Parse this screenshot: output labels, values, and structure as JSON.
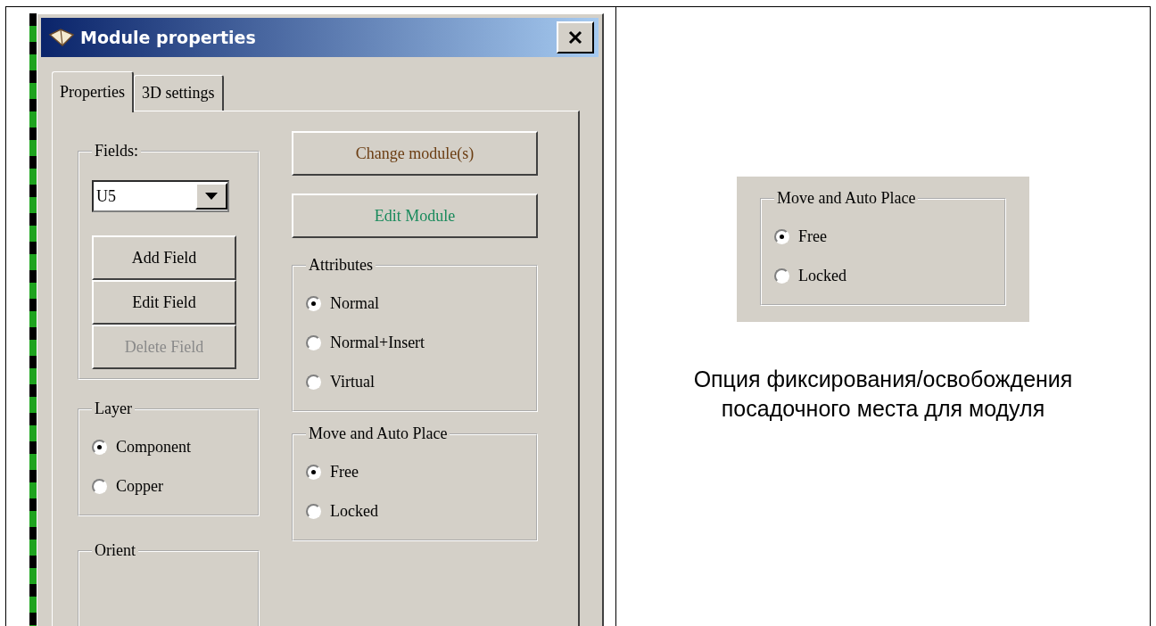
{
  "window": {
    "title": "Module properties"
  },
  "tabs": [
    {
      "label": "Properties",
      "selected": true
    },
    {
      "label": "3D settings",
      "selected": false
    }
  ],
  "fields_group": {
    "title": "Fields:",
    "dropdown_value": "U5",
    "buttons": [
      {
        "label": "Add Field",
        "disabled": false
      },
      {
        "label": "Edit Field",
        "disabled": false
      },
      {
        "label": "Delete Field",
        "disabled": true
      }
    ]
  },
  "left_groups": [
    {
      "title": "Layer",
      "options": [
        {
          "label": "Component",
          "selected": true
        },
        {
          "label": "Copper",
          "selected": false
        }
      ]
    },
    {
      "title": "Orient"
    }
  ],
  "module_buttons": [
    {
      "label": "Change module(s)",
      "color": "#6b3d12"
    },
    {
      "label": "Edit Module",
      "color": "#1a8a5c"
    }
  ],
  "right_groups": [
    {
      "title": "Attributes",
      "options": [
        {
          "label": "Normal",
          "selected": true
        },
        {
          "label": "Normal+Insert",
          "selected": false
        },
        {
          "label": "Virtual",
          "selected": false
        }
      ]
    },
    {
      "title": "Move and Auto Place",
      "options": [
        {
          "label": "Free",
          "selected": true
        },
        {
          "label": "Locked",
          "selected": false
        }
      ]
    }
  ],
  "inset": {
    "title": "Move and Auto Place",
    "options": [
      {
        "label": "Free",
        "selected": true
      },
      {
        "label": "Locked",
        "selected": false
      }
    ]
  },
  "caption": "Опция фиксирования/освобождения посадочного места для модуля"
}
